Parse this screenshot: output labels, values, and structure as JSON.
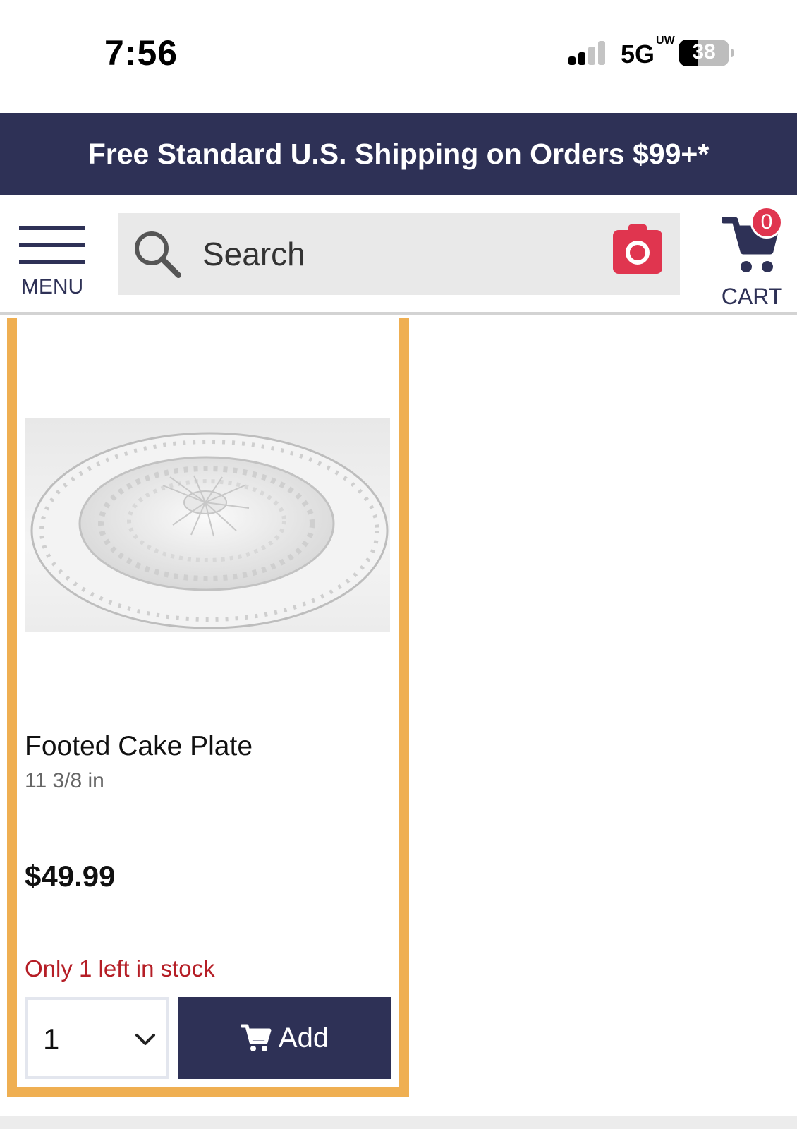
{
  "status_bar": {
    "time": "7:56",
    "network": "5G",
    "network_suffix": "UW",
    "battery": "38"
  },
  "promo_banner": {
    "text": "Free Standard U.S. Shipping on Orders $99+*"
  },
  "header": {
    "menu_label": "MENU",
    "search": {
      "placeholder": "Search",
      "value": ""
    },
    "cart_label": "CART",
    "cart_count": "0"
  },
  "product": {
    "image_icon": "glass-cake-plate-photo",
    "title": "Footed Cake Plate",
    "size": "11 3/8 in",
    "price": "$49.99",
    "stock_note": "Only 1 left in stock",
    "quantity": "1",
    "add_label": "Add"
  },
  "colors": {
    "navy": "#2e3156",
    "accent_red": "#e0354f",
    "card_border": "#efaf52",
    "stock_red": "#b51e26"
  }
}
